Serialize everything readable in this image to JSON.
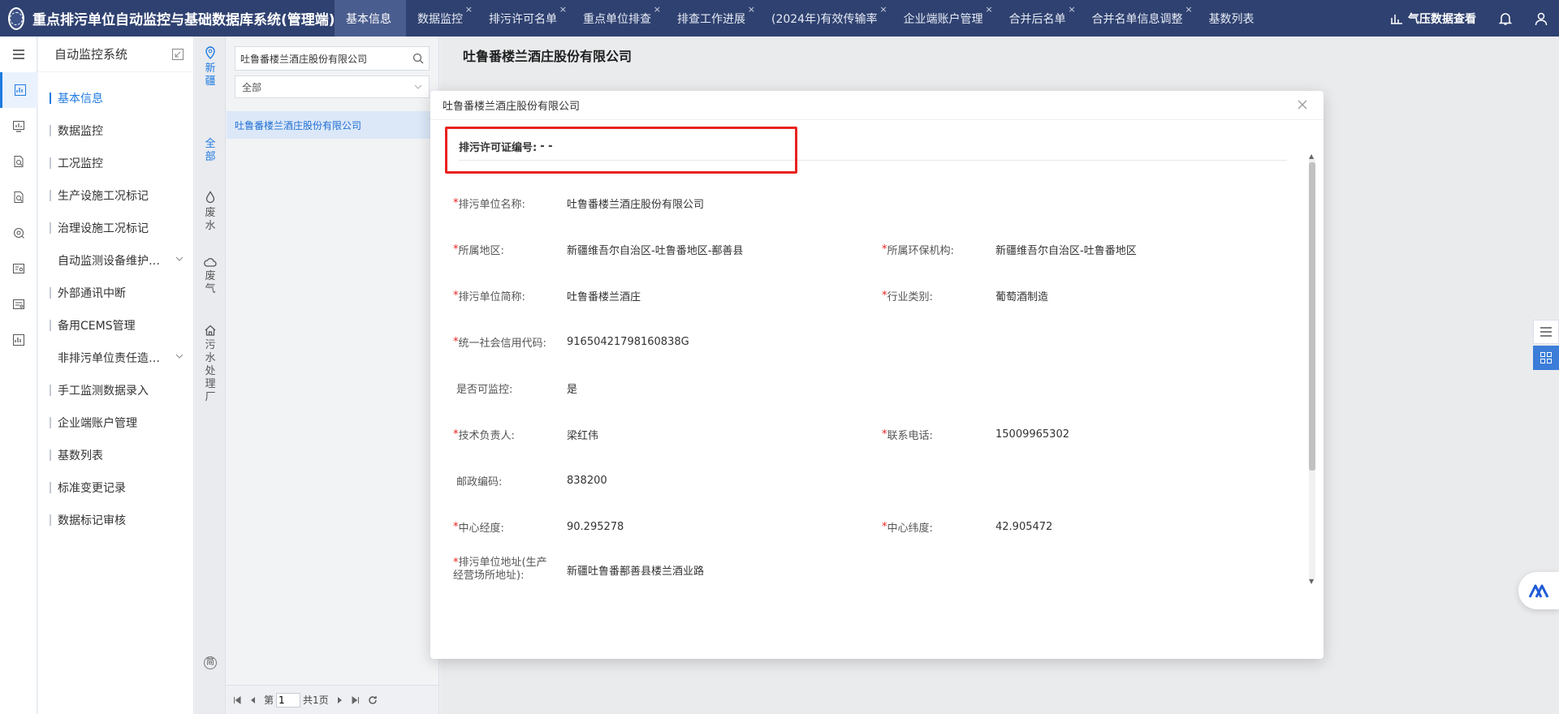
{
  "header": {
    "title": "重点排污单位自动监控与基础数据库系统(管理端)",
    "tabs": [
      {
        "label": "基本信息",
        "active": true,
        "closable": false
      },
      {
        "label": "数据监控",
        "active": false,
        "closable": true
      },
      {
        "label": "排污许可名单",
        "active": false,
        "closable": true
      },
      {
        "label": "重点单位排查",
        "active": false,
        "closable": true
      },
      {
        "label": "排查工作进展",
        "active": false,
        "closable": true
      },
      {
        "label": "(2024年)有效传输率",
        "active": false,
        "closable": true
      },
      {
        "label": "企业端账户管理",
        "active": false,
        "closable": true
      },
      {
        "label": "合并后名单",
        "active": false,
        "closable": true
      },
      {
        "label": "合并名单信息调整",
        "active": false,
        "closable": true
      },
      {
        "label": "基数列表",
        "active": false,
        "closable": false
      }
    ],
    "right_label": "气压数据查看",
    "close_glyph": "×"
  },
  "menu": {
    "title": "自动监控系统",
    "items": [
      {
        "label": "基本信息",
        "active": true,
        "expandable": false
      },
      {
        "label": "数据监控",
        "active": false,
        "expandable": false
      },
      {
        "label": "工况监控",
        "active": false,
        "expandable": false
      },
      {
        "label": "生产设施工况标记",
        "active": false,
        "expandable": false
      },
      {
        "label": "治理设施工况标记",
        "active": false,
        "expandable": false
      },
      {
        "label": "自动监测设备维护…",
        "active": false,
        "expandable": true
      },
      {
        "label": "外部通讯中断",
        "active": false,
        "expandable": false
      },
      {
        "label": "备用CEMS管理",
        "active": false,
        "expandable": false
      },
      {
        "label": "非排污单位责任造…",
        "active": false,
        "expandable": true
      },
      {
        "label": "手工监测数据录入",
        "active": false,
        "expandable": false
      },
      {
        "label": "企业端账户管理",
        "active": false,
        "expandable": false
      },
      {
        "label": "基数列表",
        "active": false,
        "expandable": false
      },
      {
        "label": "标准变更记录",
        "active": false,
        "expandable": false
      },
      {
        "label": "数据标记审核",
        "active": false,
        "expandable": false
      }
    ]
  },
  "regions": {
    "r1": "新疆",
    "r2": "全部",
    "r3": "废水",
    "r4": "废气",
    "r5": "污水处理厂",
    "r6": "简"
  },
  "company_list": {
    "search_value": "吐鲁番楼兰酒庄股份有限公司",
    "filter_value": "全部",
    "rows": [
      "吐鲁番楼兰酒庄股份有限公司"
    ],
    "pager": {
      "prefix": "第",
      "page": "1",
      "total": "共1页"
    }
  },
  "main": {
    "title": "吐鲁番楼兰酒庄股份有限公司"
  },
  "dialog": {
    "title": "吐鲁番楼兰酒庄股份有限公司",
    "permit_label": "排污许可证编号:",
    "permit_value": "- -",
    "fields": {
      "name": {
        "label": "排污单位名称:",
        "value": "吐鲁番楼兰酒庄股份有限公司"
      },
      "region": {
        "label": "所属地区:",
        "value": "新疆维吾尔自治区-吐鲁番地区-鄯善县"
      },
      "agency": {
        "label": "所属环保机构:",
        "value": "新疆维吾尔自治区-吐鲁番地区"
      },
      "short": {
        "label": "排污单位简称:",
        "value": "吐鲁番楼兰酒庄"
      },
      "industry": {
        "label": "行业类别:",
        "value": "葡萄酒制造"
      },
      "credit": {
        "label": "统一社会信用代码:",
        "value": "91650421798160838G"
      },
      "monitor": {
        "label": "是否可监控:",
        "value": "是"
      },
      "tech": {
        "label": "技术负责人:",
        "value": "梁红伟"
      },
      "phone": {
        "label": "联系电话:",
        "value": "15009965302"
      },
      "postal": {
        "label": "邮政编码:",
        "value": "838200"
      },
      "lng": {
        "label": "中心经度:",
        "value": "90.295278"
      },
      "lat": {
        "label": "中心纬度:",
        "value": "42.905472"
      },
      "addr": {
        "label": "排污单位地址(生产经营场所地址):",
        "value": "新疆吐鲁番鄯善县楼兰酒业路"
      }
    }
  },
  "colors": {
    "header_bg": "#2f4170",
    "accent": "#1f7ae0",
    "highlight": "#e8221f"
  }
}
